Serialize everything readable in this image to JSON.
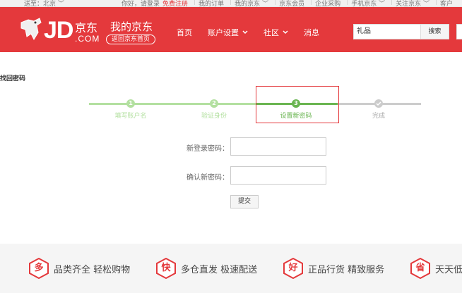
{
  "topbar": {
    "location": "送至：北京 ﹀",
    "greeting": "你好，请登录",
    "register": "免费注册",
    "links": [
      "我的订单",
      "我的京东 ﹀",
      "京东会员",
      "企业采购",
      "手机京东 ﹀",
      "关注京东 ﹀",
      "客户"
    ]
  },
  "header": {
    "logo_jd": "JD",
    "logo_cn": "京东",
    "logo_com": ".COM",
    "myjd": "我的京东",
    "back_home": "返回京东首页",
    "nav": [
      {
        "label": "首页",
        "has_dropdown": false
      },
      {
        "label": "账户设置",
        "has_dropdown": true
      },
      {
        "label": "社区",
        "has_dropdown": true
      },
      {
        "label": "消息",
        "has_dropdown": false
      }
    ],
    "search_value": "礼品",
    "search_button": "搜索"
  },
  "page_title": "找回密码",
  "steps": [
    {
      "number": "1",
      "label": "填写账户名",
      "state": "done"
    },
    {
      "number": "2",
      "label": "验证身份",
      "state": "done"
    },
    {
      "number": "3",
      "label": "设置新密码",
      "state": "active"
    },
    {
      "number": "",
      "label": "完成",
      "state": "todo"
    }
  ],
  "form": {
    "new_password_label": "新登录密码：",
    "confirm_password_label": "确认新密码：",
    "new_password_value": "",
    "confirm_password_value": "",
    "submit": "提交"
  },
  "footer": {
    "features": [
      {
        "badge": "多",
        "text": "品类齐全  轻松购物"
      },
      {
        "badge": "快",
        "text": "多仓直发  极速配送"
      },
      {
        "badge": "好",
        "text": "正品行货  精致服务"
      },
      {
        "badge": "省",
        "text": "天天低"
      }
    ]
  },
  "colors": {
    "brand_red": "#e4393c",
    "step_done": "#b3e0a0",
    "step_active": "#6ab551",
    "step_todo": "#cccccc"
  }
}
